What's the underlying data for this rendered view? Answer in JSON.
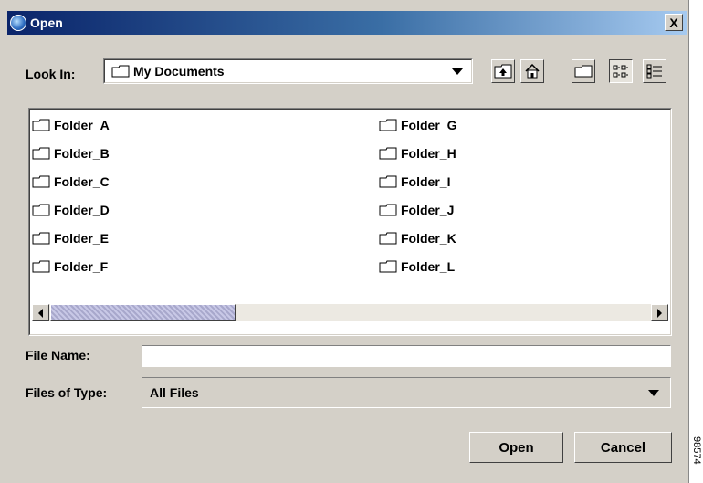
{
  "window": {
    "title": "Open",
    "close_label": "X"
  },
  "look_in": {
    "label": "Look In:",
    "value": "My Documents",
    "value_icon": "folder-icon"
  },
  "toolbar": {
    "buttons": [
      {
        "name": "up-one-level-icon"
      },
      {
        "name": "home-icon"
      },
      {
        "name": "new-folder-icon"
      },
      {
        "name": "list-view-icon",
        "pressed": true
      },
      {
        "name": "details-view-icon"
      }
    ]
  },
  "files": {
    "column1": [
      "Folder_A",
      "Folder_B",
      "Folder_C",
      "Folder_D",
      "Folder_E",
      "Folder_F"
    ],
    "column2": [
      "Folder_G",
      "Folder_H",
      "Folder_I",
      "Folder_J",
      "Folder_K",
      "Folder_L"
    ]
  },
  "file_name": {
    "label": "File Name:",
    "value": "",
    "placeholder": ""
  },
  "file_type": {
    "label": "Files of Type:",
    "value": "All Files"
  },
  "buttons": {
    "open": "Open",
    "cancel": "Cancel"
  },
  "side_mark": "98574",
  "colors": {
    "dialog_bg": "#d4d0c8",
    "title_gradient_start": "#0a246a",
    "title_gradient_end": "#a6caf0",
    "list_bg": "#ffffff"
  }
}
